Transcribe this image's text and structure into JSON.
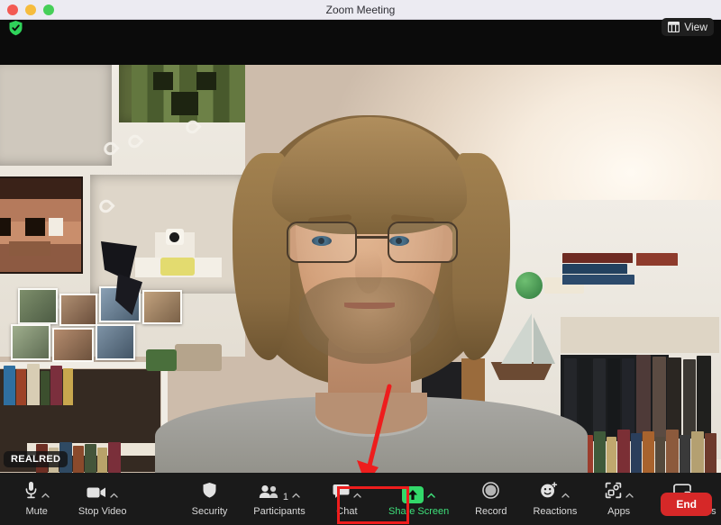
{
  "window": {
    "title": "Zoom Meeting",
    "traffic_lights": [
      "close",
      "minimize",
      "maximize"
    ]
  },
  "infobar": {
    "encryption_icon": "shield-check-icon",
    "encryption_color": "#2fd35a",
    "view_button": {
      "label": "View",
      "icon": "grid-layout-icon"
    }
  },
  "video": {
    "participant_name": "REALRED",
    "scene": "man with shoulder-length blond hair, glasses and beard seated in front of white shelving with books, photos, pixel-art posters and a model sailboat"
  },
  "annotations": {
    "arrow_color": "#ee1d1d",
    "box_color": "#ee1d1d",
    "target": "Share Screen"
  },
  "toolbar": {
    "background": "#1a1a1a",
    "items": [
      {
        "label": "Mute",
        "icon": "microphone-icon",
        "chevron": true,
        "count": null,
        "highlight": false
      },
      {
        "label": "Stop Video",
        "icon": "video-camera-icon",
        "chevron": true,
        "count": null,
        "highlight": false
      },
      {
        "label": "Security",
        "icon": "shield-icon",
        "chevron": false,
        "count": null,
        "highlight": false
      },
      {
        "label": "Participants",
        "icon": "people-icon",
        "chevron": true,
        "count": "1",
        "highlight": false
      },
      {
        "label": "Chat",
        "icon": "speech-bubble-icon",
        "chevron": true,
        "count": null,
        "highlight": false
      },
      {
        "label": "Share Screen",
        "icon": "share-screen-up-arrow-icon",
        "chevron": true,
        "count": null,
        "highlight": true
      },
      {
        "label": "Record",
        "icon": "record-circle-icon",
        "chevron": false,
        "count": null,
        "highlight": false
      },
      {
        "label": "Reactions",
        "icon": "smiley-plus-icon",
        "chevron": true,
        "count": null,
        "highlight": false
      },
      {
        "label": "Apps",
        "icon": "apps-bracket-icon",
        "chevron": true,
        "count": null,
        "highlight": false
      },
      {
        "label": "Whiteboards",
        "icon": "whiteboard-icon",
        "chevron": true,
        "count": null,
        "highlight": false
      }
    ],
    "share_screen_accent": "#33d86a",
    "end_button": {
      "label": "End",
      "color": "#d62828"
    }
  }
}
